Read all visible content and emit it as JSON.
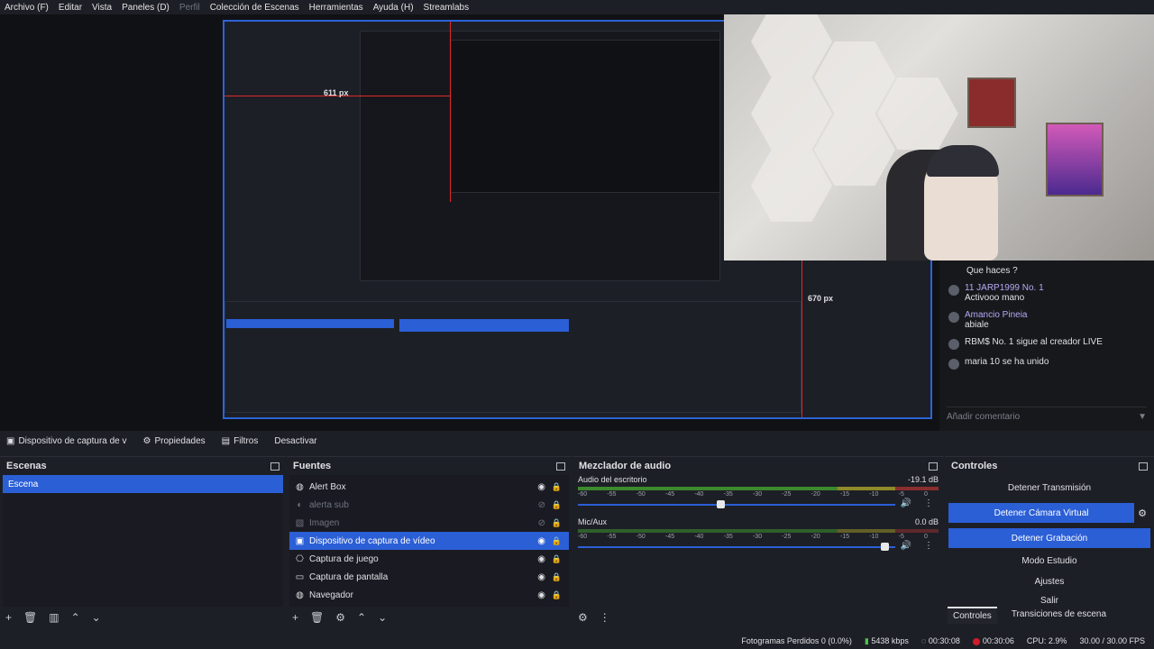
{
  "menu": {
    "items": [
      "Archivo (F)",
      "Editar",
      "Vista",
      "Paneles (D)",
      "Perfil",
      "Colección de Escenas",
      "Herramientas",
      "Ayuda (H)",
      "Streamlabs"
    ]
  },
  "preview": {
    "measure_top": "611 px",
    "measure_right": "670 px"
  },
  "chat": {
    "messages": [
      {
        "name": "",
        "text": "Que haces ?"
      },
      {
        "name": "11  JARP1999  No. 1",
        "text": "Activooo mano"
      },
      {
        "name": "Amancio Pineia",
        "text": "abiale"
      },
      {
        "name": "RBM$  No. 1",
        "text": "sigue al creador LIVE"
      },
      {
        "name": "maria  10",
        "text": "se ha unido"
      }
    ],
    "input_placeholder": "Añadir comentario"
  },
  "toolbar": {
    "source_label": "Dispositivo de captura de v",
    "properties_label": "Propiedades",
    "filters_label": "Filtros",
    "deactivate_label": "Desactivar"
  },
  "scenes": {
    "title": "Escenas",
    "items": [
      "Escena"
    ]
  },
  "sources": {
    "title": "Fuentes",
    "items": [
      {
        "label": "Alert Box",
        "icon": "globe-icon",
        "visible": true
      },
      {
        "label": "alerta sub",
        "icon": "eye-icon",
        "visible": false
      },
      {
        "label": "Imagen",
        "icon": "image-icon",
        "visible": false
      },
      {
        "label": "Dispositivo de captura de vídeo",
        "icon": "camera-icon",
        "visible": true,
        "selected": true
      },
      {
        "label": "Captura de juego",
        "icon": "gamepad-icon",
        "visible": true
      },
      {
        "label": "Captura de pantalla",
        "icon": "monitor-icon",
        "visible": true
      },
      {
        "label": "Navegador",
        "icon": "globe-icon",
        "visible": true
      }
    ]
  },
  "mixer": {
    "title": "Mezclador de audio",
    "channels": [
      {
        "name": "Audio del escritorio",
        "level": "-19.1 dB",
        "fader": 0.45
      },
      {
        "name": "Mic/Aux",
        "level": "0.0 dB",
        "fader": 0.98
      }
    ],
    "ticks": [
      "-60",
      "-55",
      "-50",
      "-45",
      "-40",
      "-35",
      "-30",
      "-25",
      "-20",
      "-15",
      "-10",
      "-5",
      "0"
    ]
  },
  "controls": {
    "title": "Controles",
    "buttons": [
      {
        "label": "Detener Transmisión",
        "active": false
      },
      {
        "label": "Detener Cámara Virtual",
        "active": true
      },
      {
        "label": "Detener Grabación",
        "active": true
      },
      {
        "label": "Modo Estudio",
        "active": false
      },
      {
        "label": "Ajustes",
        "active": false
      },
      {
        "label": "Salir",
        "active": false
      }
    ],
    "tabs": [
      "Controles",
      "Transiciones de escena"
    ]
  },
  "status": {
    "dropped": "Fotogramas Perdidos 0 (0.0%)",
    "bitrate": "5438 kbps",
    "stream_time": "00:30:08",
    "rec_time": "00:30:06",
    "cpu": "CPU: 2.9%",
    "fps": "30.00 / 30.00 FPS"
  },
  "colors": {
    "accent": "#2b5fd6",
    "record": "#d11c2a"
  }
}
